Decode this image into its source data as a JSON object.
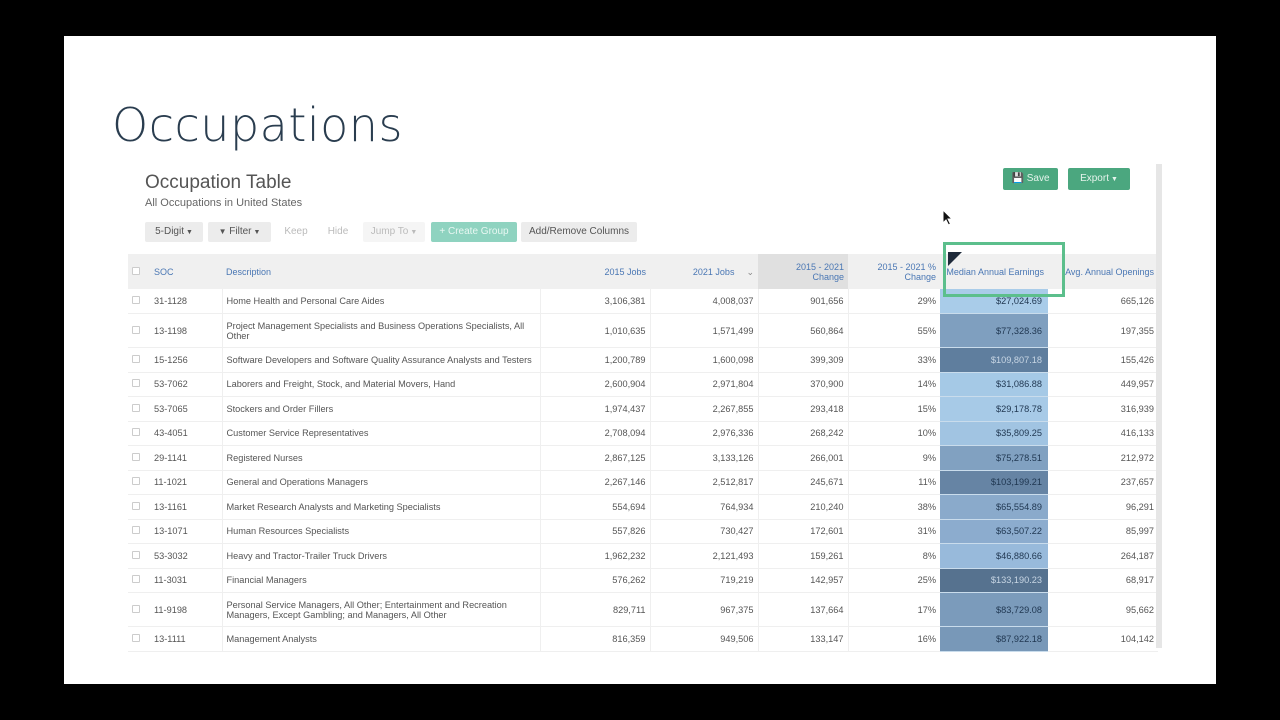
{
  "slide": {
    "title": "Occupations"
  },
  "header": {
    "title": "Occupation Table",
    "subtitle": "All Occupations in United States",
    "save_label": "Save",
    "save_icon": "floppy-disk-icon",
    "export_label": "Export"
  },
  "toolbar": {
    "digit_label": "5-Digit",
    "filter_label": "Filter",
    "filter_icon": "funnel-icon",
    "keep_label": "Keep",
    "hide_label": "Hide",
    "jump_label": "Jump To",
    "create_group_label": "+ Create Group",
    "columns_label": "Add/Remove Columns"
  },
  "colors": {
    "accent_green": "#4ba77f",
    "highlight_green": "#5cbf8c",
    "header_link": "#4a77b4",
    "title_navy": "#2a3d4f"
  },
  "table": {
    "columns": {
      "soc": "SOC",
      "description": "Description",
      "jobs2015": "2015 Jobs",
      "jobs2021": "2021 Jobs",
      "change_l1": "2015 - 2021",
      "change_l2": "Change",
      "pct_l1": "2015 - 2021 %",
      "pct_l2": "Change",
      "earnings": "Median Annual Earnings",
      "openings": "Avg. Annual Openings"
    },
    "rows": [
      {
        "soc": "31-1128",
        "desc": "Home Health and Personal Care Aides",
        "j2015": "3,106,381",
        "j2021": "4,008,037",
        "chg": "901,656",
        "pct": "29%",
        "earn": "$27,024.69",
        "open": "665,126",
        "shade": "#a9cce9"
      },
      {
        "soc": "13-1198",
        "desc": "Project Management Specialists and Business Operations Specialists, All Other",
        "j2015": "1,010,635",
        "j2021": "1,571,499",
        "chg": "560,864",
        "pct": "55%",
        "earn": "$77,328.36",
        "open": "197,355",
        "shade": "#7f9fbf",
        "tall": true
      },
      {
        "soc": "15-1256",
        "desc": "Software Developers and Software Quality Assurance Analysts and Testers",
        "j2015": "1,200,789",
        "j2021": "1,600,098",
        "chg": "399,309",
        "pct": "33%",
        "earn": "$109,807.18",
        "open": "155,426",
        "shade": "#5f7e9e",
        "light": true
      },
      {
        "soc": "53-7062",
        "desc": "Laborers and Freight, Stock, and Material Movers, Hand",
        "j2015": "2,600,904",
        "j2021": "2,971,804",
        "chg": "370,900",
        "pct": "14%",
        "earn": "$31,086.88",
        "open": "449,957",
        "shade": "#a5c9e6"
      },
      {
        "soc": "53-7065",
        "desc": "Stockers and Order Fillers",
        "j2015": "1,974,437",
        "j2021": "2,267,855",
        "chg": "293,418",
        "pct": "15%",
        "earn": "$29,178.78",
        "open": "316,939",
        "shade": "#a7cae7"
      },
      {
        "soc": "43-4051",
        "desc": "Customer Service Representatives",
        "j2015": "2,708,094",
        "j2021": "2,976,336",
        "chg": "268,242",
        "pct": "10%",
        "earn": "$35,809.25",
        "open": "416,133",
        "shade": "#a1c4e2"
      },
      {
        "soc": "29-1141",
        "desc": "Registered Nurses",
        "j2015": "2,867,125",
        "j2021": "3,133,126",
        "chg": "266,001",
        "pct": "9%",
        "earn": "$75,278.51",
        "open": "212,972",
        "shade": "#81a1c1"
      },
      {
        "soc": "11-1021",
        "desc": "General and Operations Managers",
        "j2015": "2,267,146",
        "j2021": "2,512,817",
        "chg": "245,671",
        "pct": "11%",
        "earn": "$103,199.21",
        "open": "237,657",
        "shade": "#6684a4"
      },
      {
        "soc": "13-1161",
        "desc": "Market Research Analysts and Marketing Specialists",
        "j2015": "554,694",
        "j2021": "764,934",
        "chg": "210,240",
        "pct": "38%",
        "earn": "$65,554.89",
        "open": "96,291",
        "shade": "#8aaacb"
      },
      {
        "soc": "13-1071",
        "desc": "Human Resources Specialists",
        "j2015": "557,826",
        "j2021": "730,427",
        "chg": "172,601",
        "pct": "31%",
        "earn": "$63,507.22",
        "open": "85,997",
        "shade": "#8cacce"
      },
      {
        "soc": "53-3032",
        "desc": "Heavy and Tractor-Trailer Truck Drivers",
        "j2015": "1,962,232",
        "j2021": "2,121,493",
        "chg": "159,261",
        "pct": "8%",
        "earn": "$46,880.66",
        "open": "264,187",
        "shade": "#98badb"
      },
      {
        "soc": "11-3031",
        "desc": "Financial Managers",
        "j2015": "576,262",
        "j2021": "719,219",
        "chg": "142,957",
        "pct": "25%",
        "earn": "$133,190.23",
        "open": "68,917",
        "shade": "#56728f",
        "light": true
      },
      {
        "soc": "11-9198",
        "desc": "Personal Service Managers, All Other; Entertainment and Recreation Managers, Except Gambling; and Managers, All Other",
        "j2015": "829,711",
        "j2021": "967,375",
        "chg": "137,664",
        "pct": "17%",
        "earn": "$83,729.08",
        "open": "95,662",
        "shade": "#7b9bbb",
        "tall": true
      },
      {
        "soc": "13-1111",
        "desc": "Management Analysts",
        "j2015": "816,359",
        "j2021": "949,506",
        "chg": "133,147",
        "pct": "16%",
        "earn": "$87,922.18",
        "open": "104,142",
        "shade": "#7898b8"
      }
    ]
  }
}
